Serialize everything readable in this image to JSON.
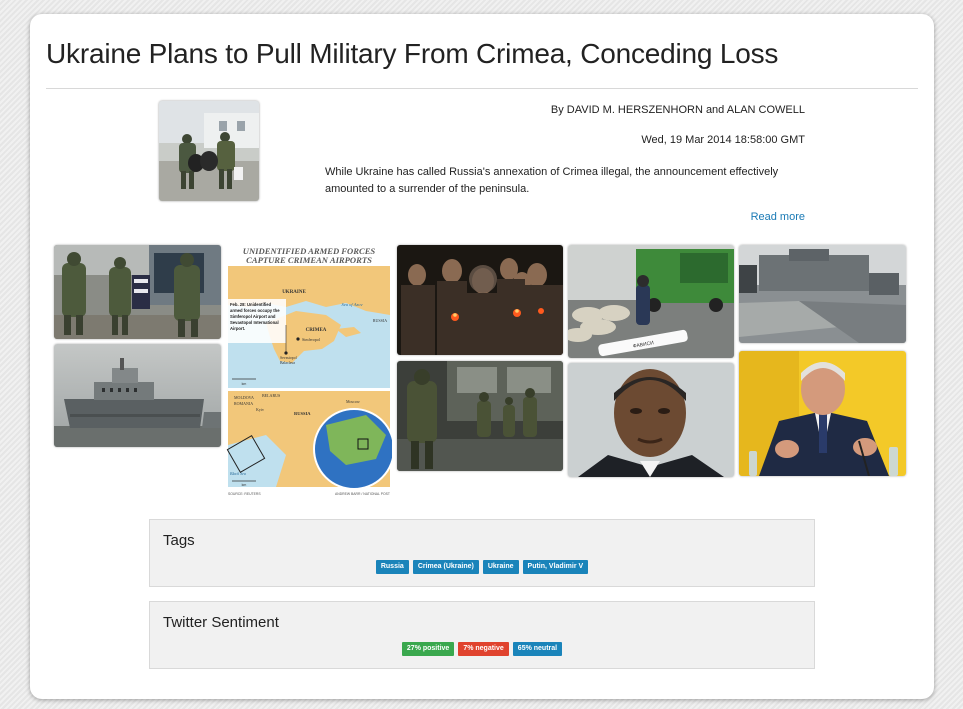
{
  "article": {
    "title": "Ukraine Plans to Pull Military From Crimea, Conceding Loss",
    "byline": "By DAVID M. HERSZENHORN and ALAN COWELL",
    "date": "Wed, 19 Mar 2014 18:58:00 GMT",
    "summary": "While Ukraine has called Russia's annexation of Crimea illegal, the announcement effectively amounted to a surrender of the peninsula.",
    "read_more": "Read more"
  },
  "infographic": {
    "title_line1": "UNIDENTIFIED ARMED FORCES",
    "title_line2": "CAPTURE CRIMEAN AIRPORTS",
    "ukraine": "UKRAINE",
    "sea_of_azov": "Sea of Azov",
    "crimea": "CRIMEA",
    "russia": "RUSSIA",
    "callout_bold": "Feb. 28:",
    "callout_lines": [
      "Feb. 28: Unidentified",
      "armed forces occupy the",
      "Simferopol Airport and",
      "Sevastopol International",
      "Airport."
    ],
    "simferopol": "Simferopol",
    "sevastopol": "Sevastopol",
    "balaclava": "Balaclava",
    "moldova": "MOLDOVA",
    "romania": "ROMANIA",
    "belarus": "BELARUS",
    "kyiv": "Kyiv",
    "moscow": "Moscow",
    "russia2": "RUSSIA",
    "black_sea": "Black Sea",
    "scale": "km",
    "source": "SOURCE: REUTERS",
    "credit": "ANDREW BARR / NATIONAL POST"
  },
  "tags": {
    "title": "Tags",
    "items": [
      "Russia",
      "Crimea (Ukraine)",
      "Ukraine",
      "Putin, Vladimir V"
    ]
  },
  "sentiment": {
    "title": "Twitter Sentiment",
    "positive": "27% positive",
    "negative": "7% negative",
    "neutral": "65% neutral",
    "colors": {
      "positive": "#3aa84e",
      "negative": "#e0432e",
      "neutral": "#1a84ba"
    }
  },
  "images": [
    "soldiers-carrying-bags-thumbnail",
    "armed-soldiers-photo",
    "navy-ship-photo",
    "crimea-map-infographic",
    "candle-vigil-photo",
    "soldiers-patrol-photo",
    "checkpoint-sandbags-photo",
    "obama-portrait-photo",
    "landing-ship-photo",
    "yanukovych-press-conference-photo"
  ],
  "colors": {
    "link": "#1a7ab5",
    "tag": "#1a84ba"
  }
}
